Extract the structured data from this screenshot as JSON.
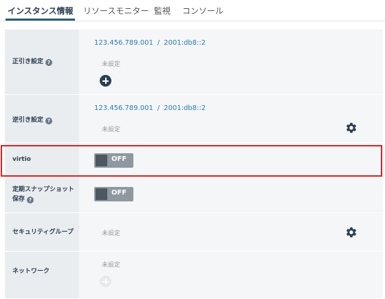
{
  "tabs": [
    {
      "label": "インスタンス情報",
      "active": true
    },
    {
      "label": "リソースモニター",
      "active": false
    },
    {
      "label": "監視",
      "active": false
    },
    {
      "label": "コンソール",
      "active": false
    }
  ],
  "rows": {
    "forward_dns": {
      "label": "正引き設定",
      "ipv4": "123.456.789.001",
      "separator": "/",
      "ipv6": "2001:db8::2",
      "status": "未設定"
    },
    "reverse_dns": {
      "label": "逆引き設定",
      "ipv4": "123.456.789.001",
      "separator": "/",
      "ipv6": "2001:db8::2",
      "status": "未設定"
    },
    "virtio": {
      "label": "virtio",
      "toggle": "OFF"
    },
    "snapshot": {
      "label_line1": "定期スナップショット",
      "label_line2": "保存",
      "toggle": "OFF"
    },
    "security_group": {
      "label": "セキュリティグループ",
      "status": "未設定"
    },
    "network": {
      "label": "ネットワーク",
      "status": "未設定"
    }
  },
  "help_glyph": "?",
  "colors": {
    "accent": "#2a5c72",
    "link": "#2a7ab0",
    "highlight": "#e02020",
    "toggle_off": "#8e989f"
  }
}
